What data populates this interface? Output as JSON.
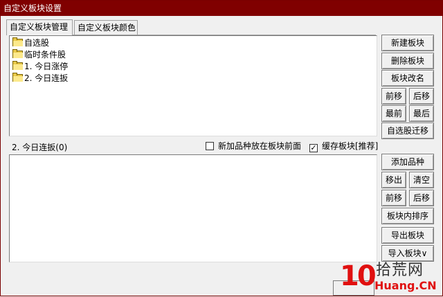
{
  "window": {
    "title": "自定义板块设置"
  },
  "tabs": [
    {
      "label": "自定义板块管理",
      "active": true
    },
    {
      "label": "自定义板块颜色",
      "active": false
    }
  ],
  "tree": {
    "items": [
      {
        "label": "自选股",
        "icon": "folder-icon"
      },
      {
        "label": "临时条件股",
        "icon": "folder-icon"
      },
      {
        "label": "1. 今日涨停",
        "icon": "folder-icon"
      },
      {
        "label": "2. 今日连扳",
        "icon": "folder-icon"
      }
    ]
  },
  "top_buttons": {
    "new": "新建板块",
    "delete": "删除板块",
    "rename": "板块改名",
    "move_up": "前移",
    "move_down": "后移",
    "first": "最前",
    "last": "最后",
    "migrate": "自选股迁移"
  },
  "selected_block": {
    "label": "2. 今日连扳(0)"
  },
  "options": {
    "new_front": {
      "label": "新加品种放在板块前面",
      "checked": false
    },
    "cache": {
      "label": "缓存板块[推荐]",
      "checked": true
    }
  },
  "bottom_buttons": {
    "add": "添加品种",
    "remove": "移出",
    "clear": "清空",
    "move_up": "前移",
    "move_down": "后移",
    "sort": "板块内排序",
    "export": "导出板块",
    "import": "导入板块∨"
  },
  "watermark": {
    "digits": "10",
    "cn": "拾荒网",
    "en": "Huang.CN"
  },
  "colors": {
    "titlebar": "#800000",
    "watermark_red": "#e01010",
    "folder": "#e8c84a"
  }
}
